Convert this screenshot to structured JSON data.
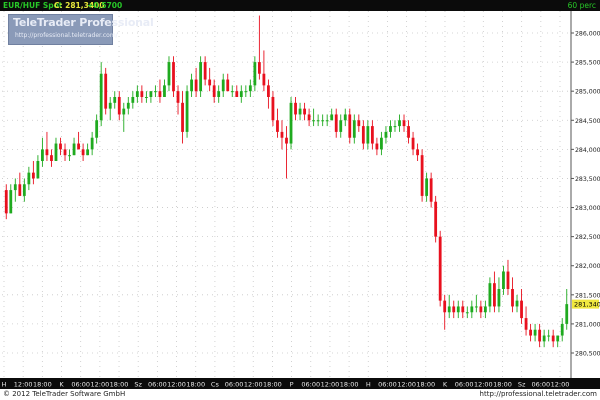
{
  "header": {
    "symbol": "EUR/HUF Spot",
    "last": "C: 281,3400",
    "change": "+0,5700",
    "period": "60 perc"
  },
  "watermark": {
    "brand": "TeleTrader Professional",
    "url": "http://professional.teletrader.com/"
  },
  "footer": {
    "copyright": "© 2012 TeleTrader Software GmbH",
    "url": "http://professional.teletrader.com"
  },
  "colors": {
    "up": "#1faa1f",
    "down": "#e8101e",
    "background": "#ffffff",
    "bar": "#0b0b0b",
    "grid": "#c8c8c8",
    "last_price_box": "#f0e840"
  },
  "chart_data": {
    "type": "candlestick",
    "title": "",
    "xlabel": "",
    "ylabel": "",
    "ylim": [
      280.3,
      286.3
    ],
    "y_ticks": [
      "286,0000",
      "285,5000",
      "285,0000",
      "284,5000",
      "284,0000",
      "283,5000",
      "283,0000",
      "282,5000",
      "282,0000",
      "281,5000",
      "281,0000",
      "280,5000"
    ],
    "y_tick_values": [
      286.0,
      285.5,
      285.0,
      284.5,
      284.0,
      283.5,
      283.0,
      282.5,
      282.0,
      281.5,
      281.0,
      280.5
    ],
    "last_price": "281,3400",
    "last_value": 281.34,
    "x_ticks": [
      "H",
      "12:00",
      "18:00",
      "K",
      "06:00",
      "12:00",
      "18:00",
      "Sz",
      "06:00",
      "12:00",
      "18:00",
      "Cs",
      "06:00",
      "12:00",
      "18:00",
      "P",
      "06:00",
      "12:00",
      "18:00",
      "H",
      "06:00",
      "12:00",
      "18:00",
      "K",
      "06:00",
      "12:00",
      "18:00",
      "Sz",
      "06:00",
      "12:00"
    ],
    "grid": true,
    "candles": [
      [
        283.3,
        283.4,
        282.8,
        282.9
      ],
      [
        282.9,
        283.4,
        282.9,
        283.3
      ],
      [
        283.3,
        283.5,
        283.1,
        283.4
      ],
      [
        283.4,
        283.6,
        283.2,
        283.2
      ],
      [
        283.2,
        283.5,
        283.1,
        283.4
      ],
      [
        283.4,
        283.7,
        283.3,
        283.6
      ],
      [
        283.6,
        283.8,
        283.4,
        283.5
      ],
      [
        283.5,
        283.9,
        283.5,
        283.8
      ],
      [
        283.8,
        284.2,
        283.7,
        284.0
      ],
      [
        284.0,
        284.3,
        283.8,
        283.9
      ],
      [
        283.9,
        284.0,
        283.7,
        283.8
      ],
      [
        283.8,
        284.2,
        283.8,
        284.1
      ],
      [
        284.1,
        284.2,
        283.9,
        284.0
      ],
      [
        284.0,
        284.1,
        283.8,
        283.9
      ],
      [
        283.9,
        284.0,
        283.8,
        283.9
      ],
      [
        283.9,
        284.2,
        283.9,
        284.1
      ],
      [
        284.1,
        284.3,
        284.0,
        284.0
      ],
      [
        284.0,
        284.1,
        283.8,
        283.9
      ],
      [
        283.9,
        284.1,
        283.9,
        284.0
      ],
      [
        284.0,
        284.3,
        283.9,
        284.2
      ],
      [
        284.2,
        284.6,
        284.1,
        284.5
      ],
      [
        284.5,
        285.5,
        284.4,
        285.3
      ],
      [
        285.3,
        285.4,
        284.6,
        284.7
      ],
      [
        284.7,
        284.9,
        284.5,
        284.8
      ],
      [
        284.8,
        285.0,
        284.7,
        284.9
      ],
      [
        284.9,
        285.0,
        284.5,
        284.6
      ],
      [
        284.6,
        284.8,
        284.3,
        284.7
      ],
      [
        284.7,
        284.9,
        284.6,
        284.8
      ],
      [
        284.8,
        285.0,
        284.7,
        284.9
      ],
      [
        284.9,
        285.1,
        284.8,
        285.0
      ],
      [
        285.0,
        285.1,
        284.8,
        284.9
      ],
      [
        284.9,
        285.0,
        284.8,
        284.9
      ],
      [
        284.9,
        285.0,
        284.8,
        285.0
      ],
      [
        285.0,
        285.1,
        284.9,
        285.0
      ],
      [
        285.0,
        285.2,
        284.8,
        284.9
      ],
      [
        284.9,
        285.2,
        284.9,
        285.1
      ],
      [
        285.1,
        285.6,
        285.0,
        285.5
      ],
      [
        285.5,
        285.6,
        284.9,
        285.0
      ],
      [
        285.0,
        285.1,
        284.6,
        284.8
      ],
      [
        284.8,
        285.0,
        284.1,
        284.3
      ],
      [
        284.3,
        285.1,
        284.2,
        285.0
      ],
      [
        285.0,
        285.3,
        284.9,
        285.2
      ],
      [
        285.2,
        285.4,
        284.9,
        285.0
      ],
      [
        285.0,
        285.6,
        284.9,
        285.5
      ],
      [
        285.5,
        285.6,
        285.1,
        285.2
      ],
      [
        285.2,
        285.4,
        285.0,
        285.1
      ],
      [
        285.1,
        285.2,
        284.8,
        284.9
      ],
      [
        284.9,
        285.1,
        284.8,
        285.0
      ],
      [
        285.0,
        285.3,
        284.9,
        285.2
      ],
      [
        285.2,
        285.3,
        285.0,
        285.0
      ],
      [
        285.0,
        285.1,
        284.9,
        285.0
      ],
      [
        285.0,
        285.1,
        284.9,
        284.9
      ],
      [
        284.9,
        285.1,
        284.8,
        285.0
      ],
      [
        285.0,
        285.1,
        284.9,
        285.0
      ],
      [
        285.0,
        285.2,
        284.9,
        285.1
      ],
      [
        285.1,
        285.6,
        285.0,
        285.5
      ],
      [
        285.5,
        286.3,
        285.2,
        285.3
      ],
      [
        285.3,
        285.7,
        285.0,
        285.1
      ],
      [
        285.1,
        285.2,
        284.7,
        284.9
      ],
      [
        284.9,
        285.0,
        284.4,
        284.5
      ],
      [
        284.5,
        284.7,
        284.2,
        284.3
      ],
      [
        284.3,
        284.5,
        284.0,
        284.2
      ],
      [
        284.2,
        284.4,
        283.5,
        284.1
      ],
      [
        284.1,
        284.9,
        284.0,
        284.8
      ],
      [
        284.8,
        284.9,
        284.5,
        284.6
      ],
      [
        284.6,
        284.8,
        284.5,
        284.7
      ],
      [
        284.7,
        284.8,
        284.5,
        284.6
      ],
      [
        284.6,
        284.7,
        284.4,
        284.5
      ],
      [
        284.5,
        284.7,
        284.4,
        284.5
      ],
      [
        284.5,
        284.6,
        284.4,
        284.5
      ],
      [
        284.5,
        284.6,
        284.4,
        284.5
      ],
      [
        284.5,
        284.6,
        284.4,
        284.5
      ],
      [
        284.5,
        284.7,
        284.5,
        284.6
      ],
      [
        284.6,
        284.7,
        284.2,
        284.3
      ],
      [
        284.3,
        284.6,
        284.2,
        284.5
      ],
      [
        284.5,
        284.7,
        284.4,
        284.6
      ],
      [
        284.6,
        284.7,
        284.1,
        284.2
      ],
      [
        284.2,
        284.6,
        284.1,
        284.5
      ],
      [
        284.5,
        284.6,
        284.3,
        284.4
      ],
      [
        284.4,
        284.5,
        284.0,
        284.1
      ],
      [
        284.1,
        284.5,
        284.0,
        284.4
      ],
      [
        284.4,
        284.5,
        284.0,
        284.1
      ],
      [
        284.1,
        284.2,
        283.9,
        284.0
      ],
      [
        284.0,
        284.3,
        283.9,
        284.2
      ],
      [
        284.2,
        284.4,
        284.1,
        284.3
      ],
      [
        284.3,
        284.5,
        284.2,
        284.4
      ],
      [
        284.4,
        284.5,
        284.3,
        284.4
      ],
      [
        284.4,
        284.6,
        284.3,
        284.5
      ],
      [
        284.5,
        284.6,
        284.3,
        284.4
      ],
      [
        284.4,
        284.5,
        284.1,
        284.2
      ],
      [
        284.2,
        284.3,
        283.9,
        284.0
      ],
      [
        284.0,
        284.1,
        283.8,
        283.9
      ],
      [
        283.9,
        284.0,
        283.1,
        283.2
      ],
      [
        283.2,
        283.6,
        283.1,
        283.5
      ],
      [
        283.5,
        283.6,
        283.0,
        283.1
      ],
      [
        283.1,
        283.2,
        282.4,
        282.5
      ],
      [
        282.5,
        282.6,
        281.3,
        281.4
      ],
      [
        281.4,
        281.5,
        280.9,
        281.2
      ],
      [
        281.2,
        281.5,
        281.1,
        281.3
      ],
      [
        281.3,
        281.4,
        281.1,
        281.2
      ],
      [
        281.2,
        281.4,
        281.1,
        281.3
      ],
      [
        281.3,
        281.4,
        281.1,
        281.2
      ],
      [
        281.2,
        281.3,
        281.1,
        281.2
      ],
      [
        281.2,
        281.4,
        281.1,
        281.3
      ],
      [
        281.3,
        281.5,
        281.2,
        281.3
      ],
      [
        281.3,
        281.4,
        281.1,
        281.2
      ],
      [
        281.2,
        281.4,
        281.1,
        281.3
      ],
      [
        281.3,
        281.8,
        281.2,
        281.7
      ],
      [
        281.7,
        281.9,
        281.2,
        281.3
      ],
      [
        281.3,
        281.8,
        281.2,
        281.6
      ],
      [
        281.6,
        282.0,
        281.5,
        281.9
      ],
      [
        281.9,
        282.1,
        281.5,
        281.6
      ],
      [
        281.6,
        281.8,
        281.2,
        281.3
      ],
      [
        281.3,
        281.5,
        281.2,
        281.4
      ],
      [
        281.4,
        281.6,
        281.0,
        281.1
      ],
      [
        281.1,
        281.3,
        280.8,
        280.9
      ],
      [
        280.9,
        281.0,
        280.7,
        280.8
      ],
      [
        280.8,
        281.0,
        280.7,
        280.9
      ],
      [
        280.9,
        281.0,
        280.6,
        280.7
      ],
      [
        280.7,
        280.9,
        280.6,
        280.8
      ],
      [
        280.8,
        280.9,
        280.7,
        280.8
      ],
      [
        280.8,
        280.9,
        280.6,
        280.7
      ],
      [
        280.7,
        280.8,
        280.6,
        280.8
      ],
      [
        280.8,
        281.1,
        280.7,
        281.0
      ],
      [
        281.0,
        281.6,
        280.9,
        281.34
      ]
    ]
  }
}
